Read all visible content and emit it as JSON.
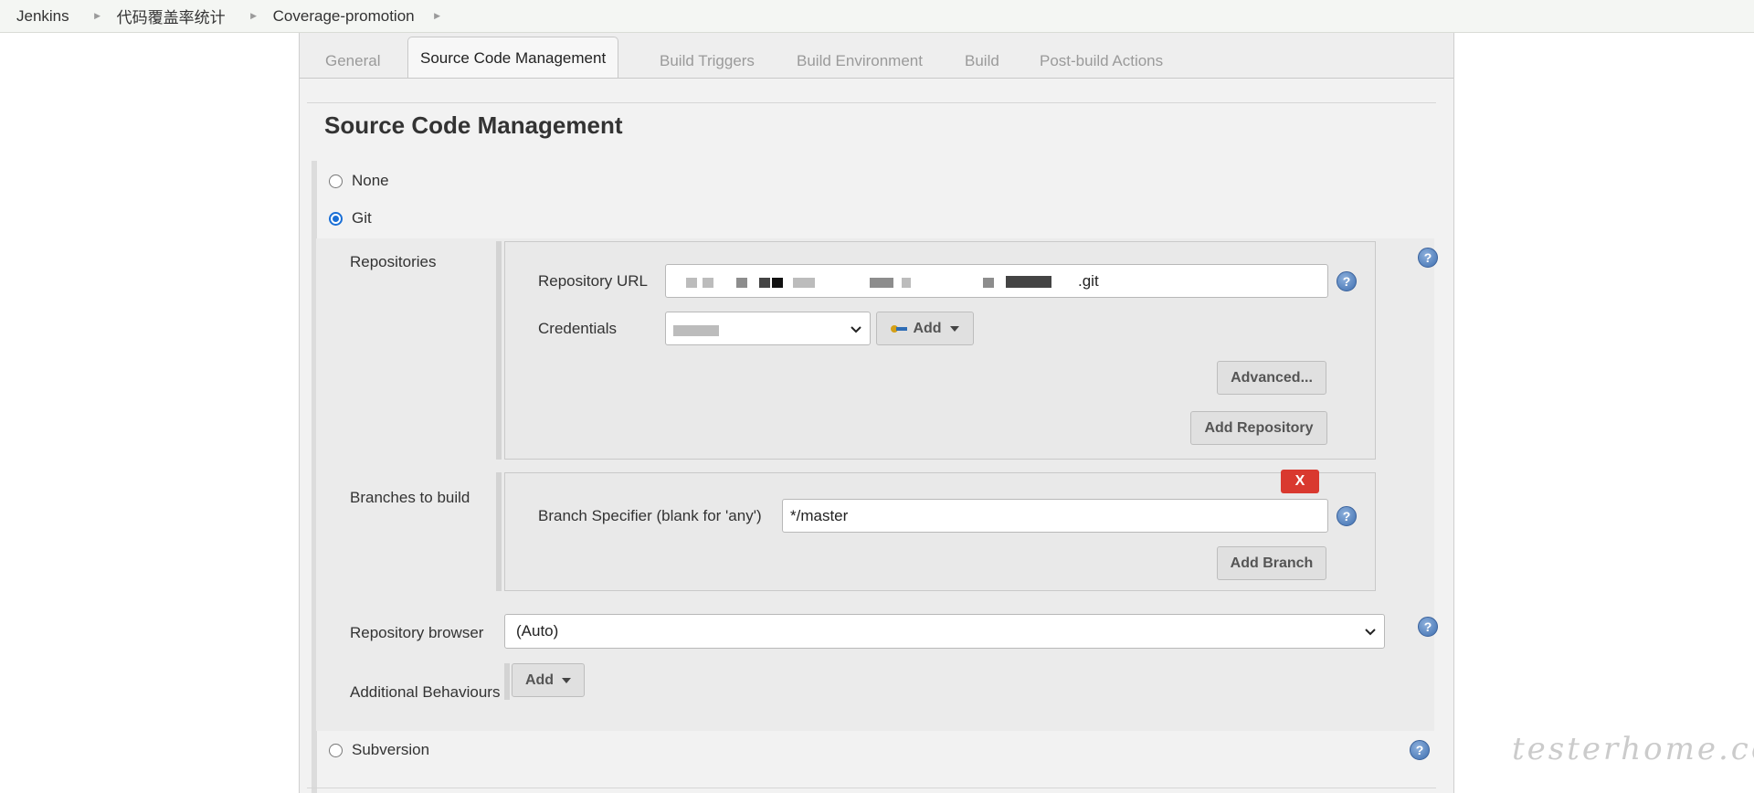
{
  "breadcrumb": {
    "items": [
      "Jenkins",
      "代码覆盖率统计",
      "Coverage-promotion"
    ]
  },
  "tabs": [
    "General",
    "Source Code Management",
    "Build Triggers",
    "Build Environment",
    "Build",
    "Post-build Actions"
  ],
  "active_tab": "Source Code Management",
  "section_title": "Source Code Management",
  "scm_options": {
    "none": "None",
    "git": "Git",
    "subversion": "Subversion",
    "selected": "Git"
  },
  "git": {
    "repositories_label": "Repositories",
    "repository_url_label": "Repository URL",
    "repository_url_value": ".git",
    "credentials_label": "Credentials",
    "add_label": "Add",
    "advanced_label": "Advanced...",
    "add_repository_label": "Add Repository",
    "branches_label": "Branches to build",
    "delete_label": "X",
    "branch_specifier_label": "Branch Specifier (blank for 'any')",
    "branch_specifier_value": "*/master",
    "add_branch_label": "Add Branch",
    "repository_browser_label": "Repository browser",
    "repository_browser_value": "(Auto)",
    "additional_behaviours_label": "Additional Behaviours",
    "additional_add_label": "Add"
  },
  "help_glyph": "?",
  "watermark": "testerhome.com",
  "colors": {
    "delete_button": "#d9392f",
    "help_icon": "#3f6fb0",
    "radio_checked": "#1a6fd6"
  }
}
